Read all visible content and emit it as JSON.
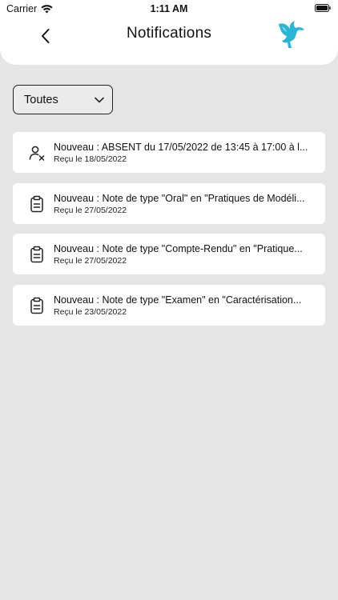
{
  "status_bar": {
    "carrier": "Carrier",
    "time": "1:11 AM"
  },
  "header": {
    "title": "Notifications",
    "back_icon": "chevron-left-icon",
    "logo_icon": "pegasus-logo"
  },
  "filter": {
    "selected": "Toutes",
    "icon": "chevron-down-icon"
  },
  "notifications": [
    {
      "icon": "user-x-icon",
      "title": "Nouveau : ABSENT du 17/05/2022 de 13:45 à 17:00 à l...",
      "date": "Reçu le 18/05/2022"
    },
    {
      "icon": "clipboard-icon",
      "title": "Nouveau : Note de type \"Oral\" en \"Pratiques de Modéli...",
      "date": "Reçu le 27/05/2022"
    },
    {
      "icon": "clipboard-icon",
      "title": "Nouveau : Note de type \"Compte-Rendu\" en \"Pratique...",
      "date": "Reçu le 27/05/2022"
    },
    {
      "icon": "clipboard-icon",
      "title": "Nouveau : Note de type \"Examen\" en \"Caractérisation...",
      "date": "Reçu le 23/05/2022"
    }
  ],
  "colors": {
    "background": "#e5e5e5",
    "card": "#ffffff",
    "logo_accent": "#29b6d6"
  }
}
